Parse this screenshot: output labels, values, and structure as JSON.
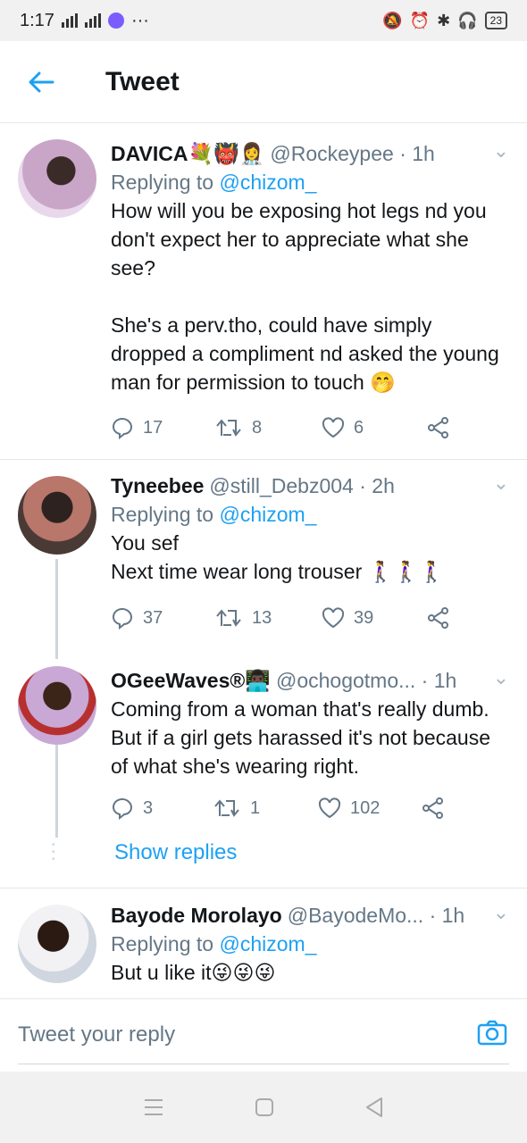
{
  "status_bar": {
    "time": "1:17",
    "more": "···",
    "battery": "23"
  },
  "header": {
    "title": "Tweet"
  },
  "tweets": [
    {
      "name": "DAVICA💐👹👩‍⚕️",
      "handle": "@Rockeypee · 1h",
      "replying_prefix": "Replying to ",
      "replying_to": "@chizom_",
      "text": "How will you be exposing hot legs nd you don't expect her to appreciate what she see?\n\nShe's a perv.tho,  could have simply dropped a compliment nd asked the young man for permission to touch 🤭",
      "replies": "17",
      "retweets": "8",
      "likes": "6"
    },
    {
      "name": "Tyneebee",
      "handle": "@still_Debz004 · 2h",
      "replying_prefix": "Replying to ",
      "replying_to": "@chizom_",
      "text": "You sef\nNext time wear long trouser 🚶‍♀️🚶‍♀️🚶‍♀️",
      "replies": "37",
      "retweets": "13",
      "likes": "39"
    },
    {
      "name": "OGeeWaves®👨🏿‍💻",
      "handle": "@ochogotmo... · 1h",
      "text": "Coming from a woman that's really dumb. But if a girl gets harassed it's not because of what she's wearing right.",
      "replies": "3",
      "retweets": "1",
      "likes": "102"
    },
    {
      "name": "Bayode Morolayo",
      "handle": "@BayodeMo... · 1h",
      "replying_prefix": "Replying to ",
      "replying_to": "@chizom_",
      "text": "But u like it😜😜😜"
    }
  ],
  "show_replies": "Show replies",
  "reply_bar": {
    "placeholder": "Tweet your reply"
  },
  "colors": {
    "accent": "#1da1f2",
    "muted": "#657786",
    "divider": "#e1e8ed"
  },
  "icons": [
    "back-arrow-icon",
    "chevron-down-icon",
    "reply-icon",
    "retweet-icon",
    "like-icon",
    "share-icon",
    "camera-icon"
  ]
}
